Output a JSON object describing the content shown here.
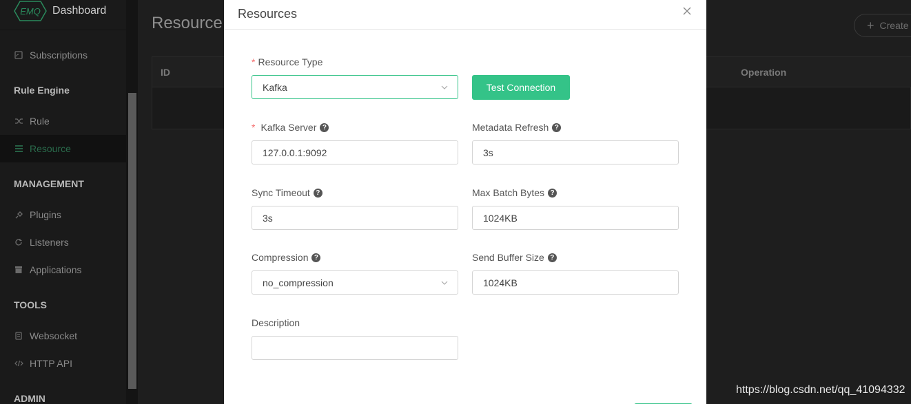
{
  "sidebar": {
    "logo_mark": "EMQ",
    "logo_text": "Dashboard",
    "items": [
      {
        "label": "Subscriptions",
        "icon": "subscriptions-icon"
      },
      {
        "label": "Rule",
        "icon": "shuffle-icon"
      },
      {
        "label": "Resource",
        "icon": "list-icon",
        "active": true
      },
      {
        "label": "Plugins",
        "icon": "plug-icon"
      },
      {
        "label": "Listeners",
        "icon": "refresh-icon"
      },
      {
        "label": "Applications",
        "icon": "archive-icon"
      },
      {
        "label": "Websocket",
        "icon": "websocket-icon"
      },
      {
        "label": "HTTP API",
        "icon": "code-icon"
      }
    ],
    "groups": {
      "rule_engine": "Rule Engine",
      "management": "MANAGEMENT",
      "tools": "TOOLS",
      "admin": "ADMIN"
    }
  },
  "main": {
    "title": "Resource",
    "create_label": "Create",
    "table": {
      "columns": [
        "ID",
        "Operation"
      ]
    }
  },
  "modal": {
    "title": "Resources",
    "test_connection_label": "Test Connection",
    "fields": {
      "resource_type": {
        "label": "Resource Type",
        "value": "Kafka",
        "required": true
      },
      "kafka_server": {
        "label": "Kafka Server",
        "value": "127.0.0.1:9092",
        "required": true
      },
      "metadata_refresh": {
        "label": "Metadata Refresh",
        "value": "3s"
      },
      "sync_timeout": {
        "label": "Sync Timeout",
        "value": "3s"
      },
      "max_batch_bytes": {
        "label": "Max Batch Bytes",
        "value": "1024KB"
      },
      "compression": {
        "label": "Compression",
        "value": "no_compression"
      },
      "send_buffer_size": {
        "label": "Send Buffer Size",
        "value": "1024KB"
      },
      "description": {
        "label": "Description",
        "value": ""
      }
    }
  },
  "watermark": "https://blog.csdn.net/qq_41094332",
  "colors": {
    "accent": "#34c388",
    "required": "#f56c6c",
    "sidebar_bg": "#1a1a1a"
  }
}
